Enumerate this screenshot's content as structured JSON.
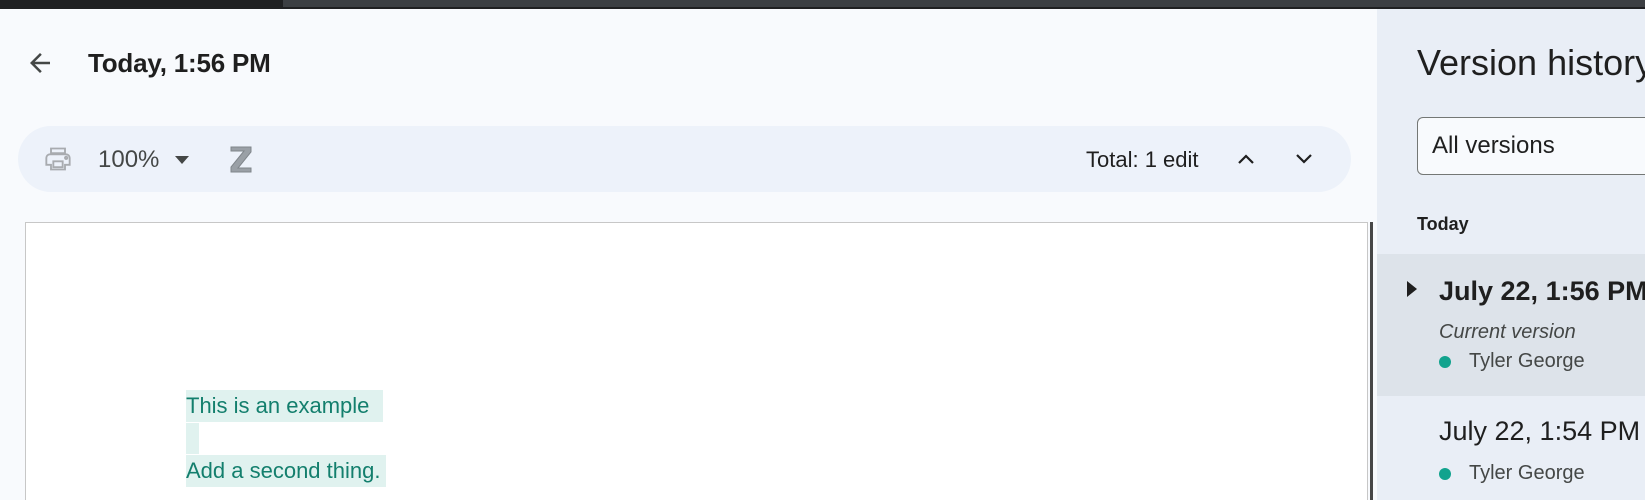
{
  "header": {
    "title": "Today, 1:56 PM"
  },
  "toolbar": {
    "zoom": "100%",
    "total_edits": "Total: 1 edit"
  },
  "document": {
    "lines": [
      "This is an example",
      "Add a second thing."
    ]
  },
  "side_panel": {
    "title": "Version history",
    "filter": {
      "selected": "All versions"
    },
    "group_label": "Today",
    "versions": [
      {
        "time": "July 22, 1:56 PM",
        "label": "Current version",
        "author": "Tyler George"
      },
      {
        "time": "July 22, 1:54 PM",
        "author": "Tyler George"
      }
    ]
  },
  "colors": {
    "added_text": "#137f6d",
    "added_highlight": "#e0f2ef",
    "author_dot": "#12a38e",
    "selected_version_bg": "#dde3ea"
  }
}
